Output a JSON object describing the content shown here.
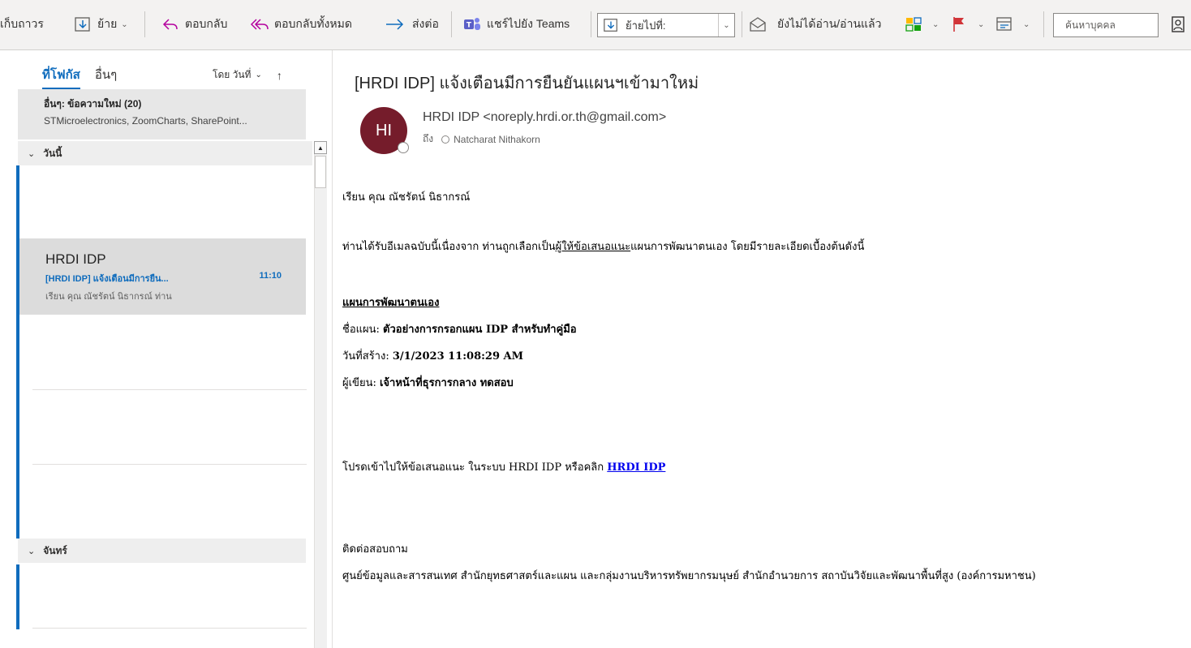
{
  "toolbar": {
    "archive_label": "เก็บถาวร",
    "move_label": "ย้าย",
    "reply_label": "ตอบกลับ",
    "reply_all_label": "ตอบกลับทั้งหมด",
    "forward_label": "ส่งต่อ",
    "share_teams_label": "แชร์ไปยัง Teams",
    "move_to_placeholder": "ย้ายไปที่:",
    "read_unread_label": "ยังไม่ได้อ่าน/อ่านแล้ว",
    "search_people_placeholder": "ค้นหาบุคคล"
  },
  "message_list": {
    "tab_focused": "ที่โฟกัส",
    "tab_other": "อื่นๆ",
    "sort_label": "โดย วันที่",
    "other_banner_title": "อื่นๆ: ข้อความใหม่ (20)",
    "other_banner_senders": "STMicroelectronics, ZoomCharts, SharePoint...",
    "group_today": "วันนี้",
    "group_monday": "จันทร์",
    "selected_item": {
      "sender": "HRDI IDP",
      "subject": "[HRDI IDP] แจ้งเตือนมีการยืน...",
      "time": "11:10",
      "preview": "เรียน คุณ ณัชรัตน์ นิธากรณ์  ท่าน"
    }
  },
  "reading_pane": {
    "subject": "[HRDI IDP] แจ้งเตือนมีการยืนยันแผนฯเข้ามาใหม่",
    "avatar_initials": "HI",
    "from": "HRDI IDP <noreply.hrdi.or.th@gmail.com>",
    "to_label": "ถึง",
    "to_name": "Natcharat Nithakorn",
    "greeting": "เรียน คุณ ณัชรัตน์ นิธากรณ์",
    "intro_before": "ท่านได้รับอีเมลฉบับนี้เนื่องจาก ท่านถูกเลือกเป็น",
    "intro_underlined": "ผู้ให้ข้อเสนอแนะ",
    "intro_after": "แผนการพัฒนาตนเอง โดยมีรายละเอียดเบื้องต้นดังนี้",
    "plan_heading": "แผนการพัฒนาตนเอง",
    "plan_name_label": "ชื่อแผน: ",
    "plan_name_value": "ตัวอย่างการกรอกแผน IDP สำหรับทำคู่มือ",
    "created_label": "วันที่สร้าง: ",
    "created_value": "3/1/2023 11:08:29 AM",
    "author_label": "ผู้เขียน: ",
    "author_value": "เจ้าหน้าที่ธุรการกลาง ทดสอบ",
    "cta_text": "โปรดเข้าไปให้ข้อเสนอแนะ ในระบบ HRDI IDP หรือคลิก ",
    "cta_link": "HRDI IDP",
    "contact_heading": "ติดต่อสอบถาม",
    "contact_org": "ศูนย์ข้อมูลและสารสนเทศ สำนักยุทธศาสตร์และแผน และกลุ่มงานบริหารทรัพยากรมนุษย์ สำนักอำนวยการ สถาบันวิจัยและพัฒนาพื้นที่สูง (องค์การมหาชน)"
  },
  "colors": {
    "accent": "#0f6cbd",
    "avatar_bg": "#751c2b",
    "flag_red": "#d13438"
  }
}
